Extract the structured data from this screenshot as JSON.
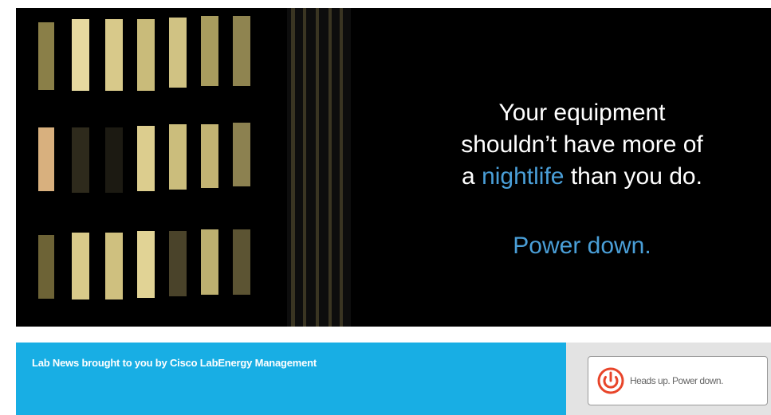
{
  "banner": {
    "headline_line1": "Your equipment",
    "headline_line2": "shouldn’t have more of",
    "headline_line3_prefix": "a ",
    "headline_highlight": "nightlife",
    "headline_line3_suffix": " than you do.",
    "tagline": "Power down."
  },
  "footer": {
    "credit": "Lab News brought to you by Cisco LabEnergy Management",
    "badge_label": "Heads up. Power down."
  },
  "colors": {
    "highlight_blue": "#4a9fd8",
    "footer_blue": "#18aee4",
    "power_icon_red": "#e8452a"
  },
  "icons": {
    "badge_icon": "power-icon"
  }
}
